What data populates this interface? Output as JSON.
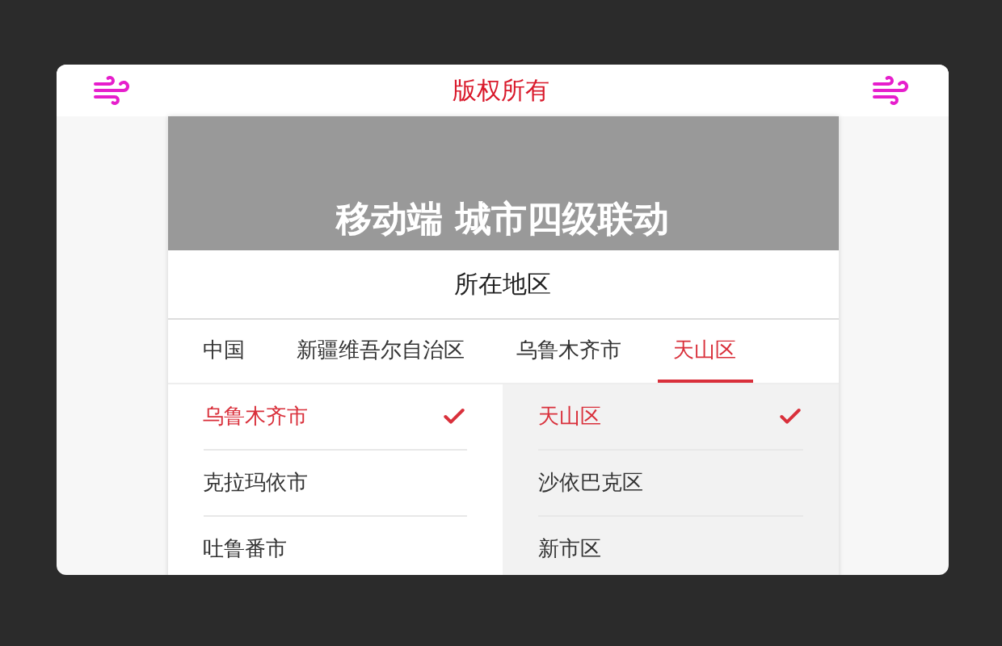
{
  "header": {
    "title": "版权所有"
  },
  "banner": {
    "title": "移动端 城市四级联动"
  },
  "section": {
    "title": "所在地区"
  },
  "tabs": [
    {
      "label": "中国",
      "selected": false
    },
    {
      "label": "新疆维吾尔自治区",
      "selected": false
    },
    {
      "label": "乌鲁木齐市",
      "selected": false
    },
    {
      "label": "天山区",
      "selected": true
    }
  ],
  "columns": [
    {
      "active": false,
      "items": [
        {
          "label": "乌鲁木齐市",
          "selected": true
        },
        {
          "label": "克拉玛依市",
          "selected": false
        },
        {
          "label": "吐鲁番市",
          "selected": false
        }
      ]
    },
    {
      "active": true,
      "items": [
        {
          "label": "天山区",
          "selected": true
        },
        {
          "label": "沙依巴克区",
          "selected": false
        },
        {
          "label": "新市区",
          "selected": false
        }
      ]
    }
  ]
}
